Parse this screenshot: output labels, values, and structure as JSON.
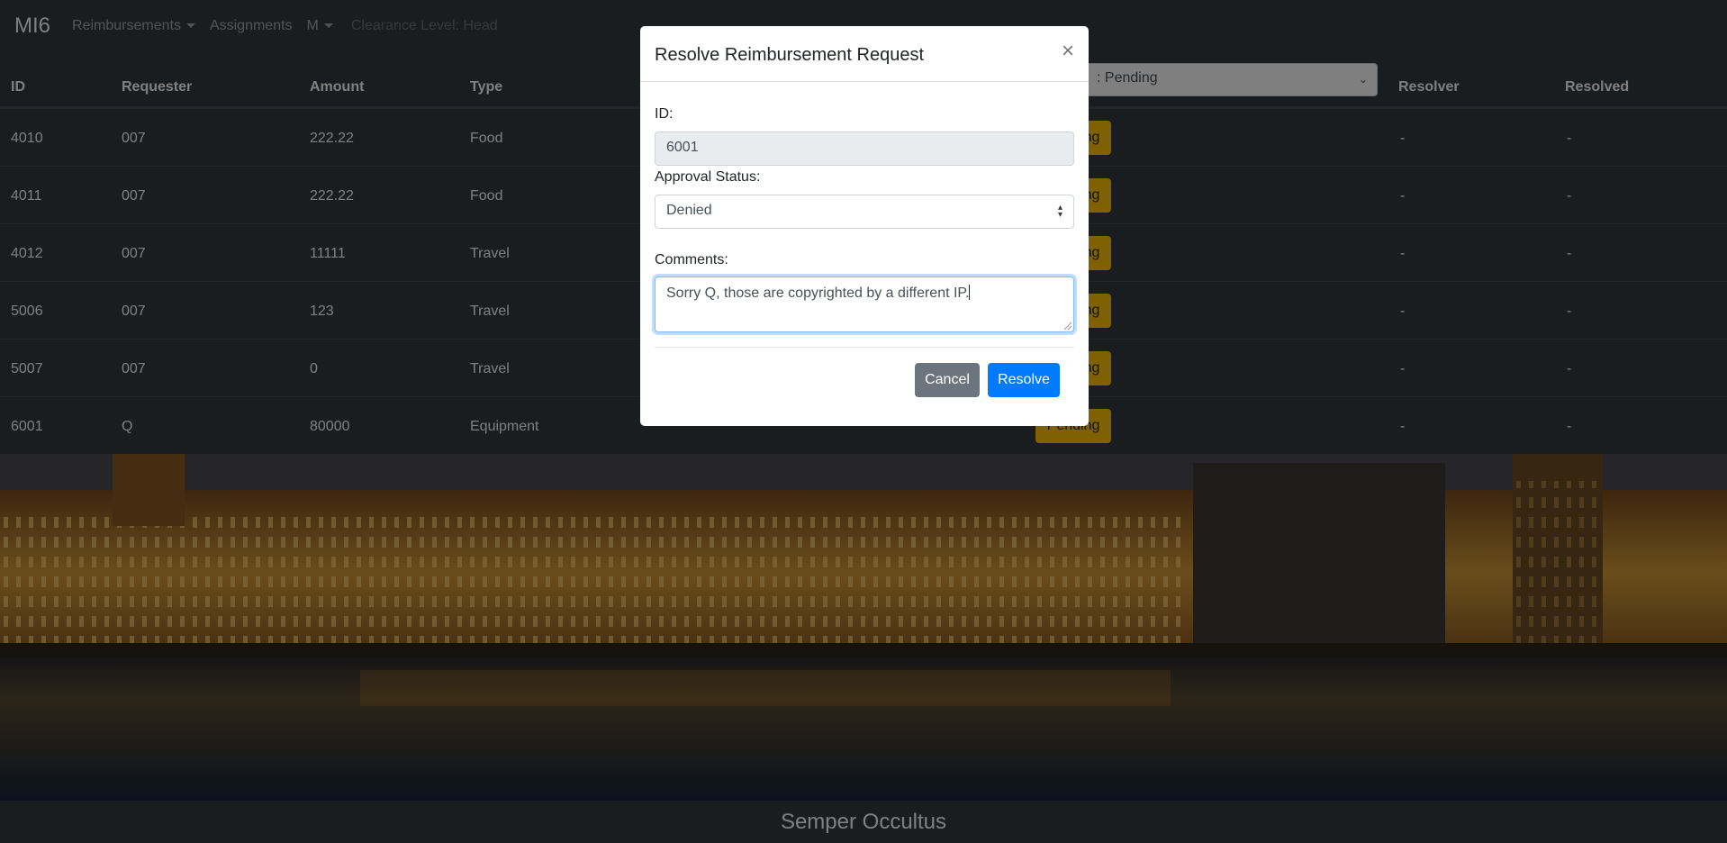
{
  "navbar": {
    "brand": "MI6",
    "links": [
      "Reimbursements",
      "Assignments",
      "M"
    ],
    "clearance": "Clearance Level: Head"
  },
  "table": {
    "headers": [
      "ID",
      "Requester",
      "Amount",
      "Type",
      "Resolver",
      "Resolved"
    ],
    "status_filter": ": Pending",
    "rows": [
      {
        "id": "4010",
        "requester": "007",
        "amount": "222.22",
        "type": "Food",
        "status": "Pending",
        "resolver": "-",
        "resolved": "-"
      },
      {
        "id": "4011",
        "requester": "007",
        "amount": "222.22",
        "type": "Food",
        "status": "Pending",
        "resolver": "-",
        "resolved": "-"
      },
      {
        "id": "4012",
        "requester": "007",
        "amount": "11111",
        "type": "Travel",
        "status": "Pending",
        "resolver": "-",
        "resolved": "-"
      },
      {
        "id": "5006",
        "requester": "007",
        "amount": "123",
        "type": "Travel",
        "status": "Pending",
        "resolver": "-",
        "resolved": "-"
      },
      {
        "id": "5007",
        "requester": "007",
        "amount": "0",
        "type": "Travel",
        "status": "Pending",
        "resolver": "-",
        "resolved": "-"
      },
      {
        "id": "6001",
        "requester": "Q",
        "amount": "80000",
        "type": "Equipment",
        "status": "Pending",
        "resolver": "-",
        "resolved": "-"
      }
    ]
  },
  "footer": {
    "motto": "Semper Occultus"
  },
  "modal": {
    "title": "Resolve Reimbursement Request",
    "close": "×",
    "id_label": "ID:",
    "id_value": "6001",
    "status_label": "Approval Status:",
    "status_value": "Denied",
    "comments_label": "Comments:",
    "comments_value": "Sorry Q, those are copyrighted by a different IP.",
    "cancel_label": "Cancel",
    "resolve_label": "Resolve"
  },
  "colors": {
    "navbar": "#343a40",
    "warning": "#ffc107",
    "primary": "#007bff",
    "secondary": "#6c757d"
  }
}
